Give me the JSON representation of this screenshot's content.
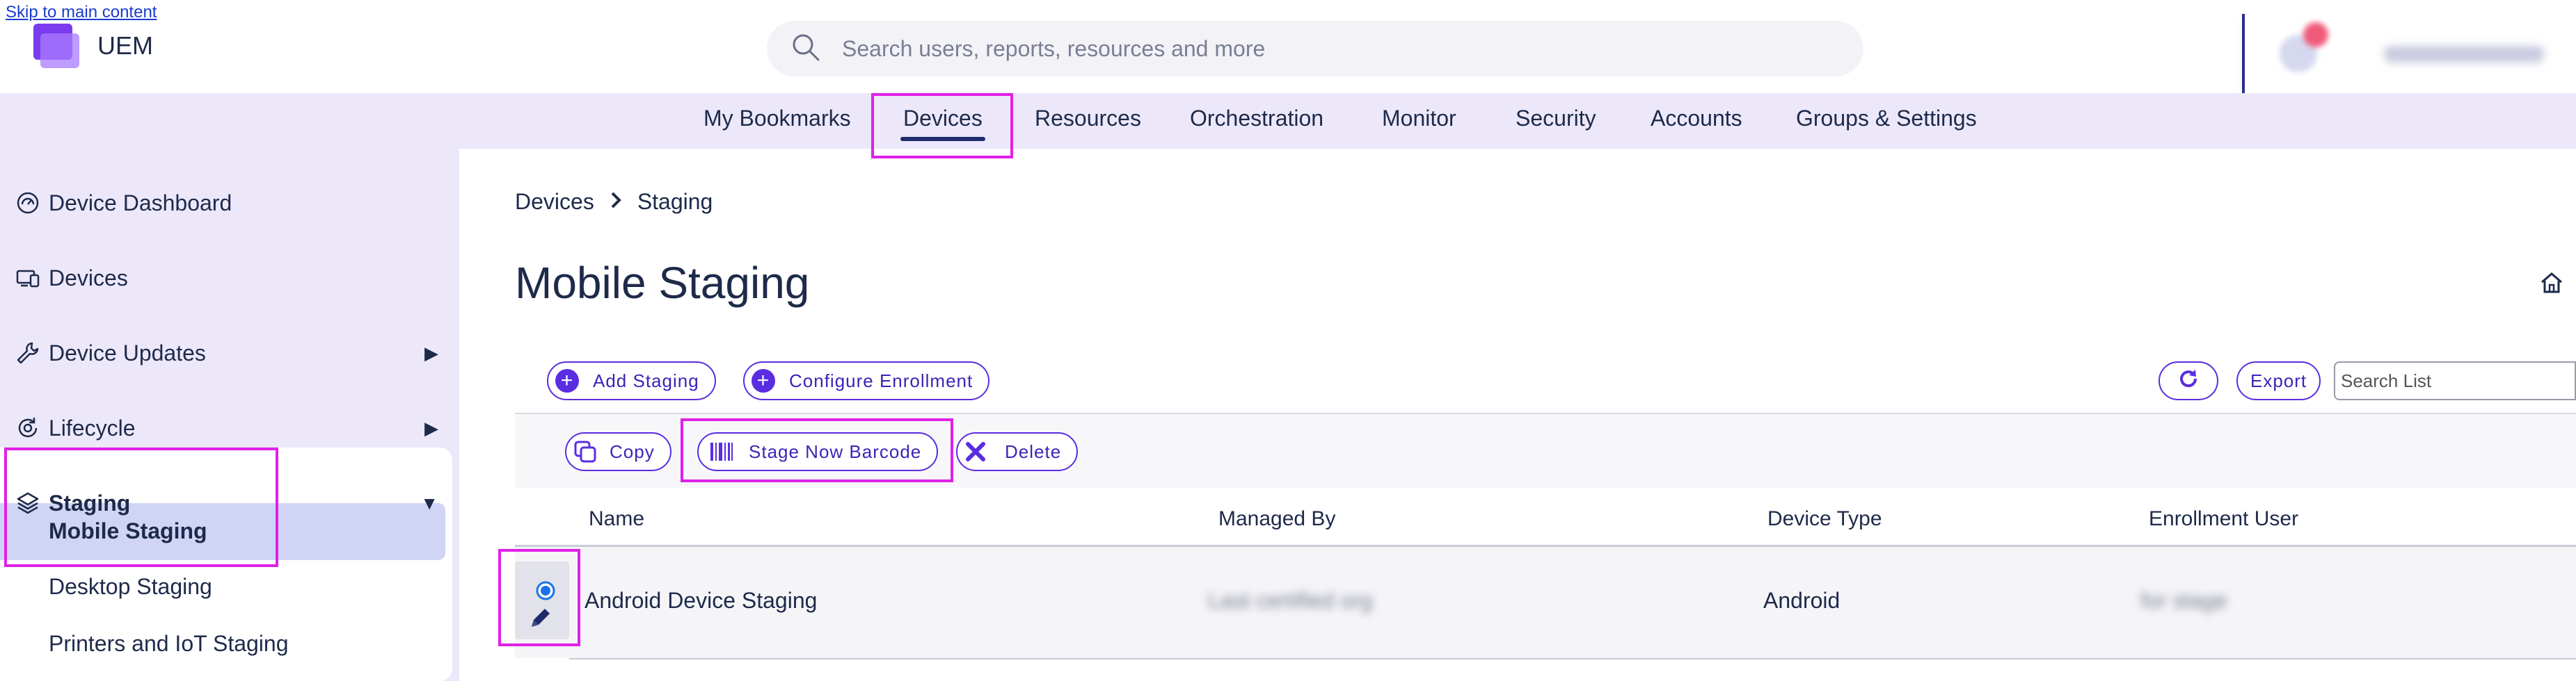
{
  "header": {
    "skip_link": "Skip to main content",
    "app_name": "UEM",
    "search_placeholder": "Search users, reports, resources and more"
  },
  "top_nav": {
    "tabs": [
      {
        "label": "My Bookmarks"
      },
      {
        "label": "Devices",
        "active": true
      },
      {
        "label": "Resources"
      },
      {
        "label": "Orchestration"
      },
      {
        "label": "Monitor"
      },
      {
        "label": "Security"
      },
      {
        "label": "Accounts"
      },
      {
        "label": "Groups & Settings"
      }
    ]
  },
  "sidebar": {
    "items": [
      {
        "label": "Device Dashboard",
        "icon": "dashboard-icon"
      },
      {
        "label": "Devices",
        "icon": "devices-icon"
      },
      {
        "label": "Device Updates",
        "icon": "wrench-icon",
        "expandable": true
      },
      {
        "label": "Lifecycle",
        "icon": "lifecycle-icon",
        "expandable": true
      },
      {
        "label": "Staging",
        "icon": "layers-icon",
        "expanded": true
      }
    ],
    "staging_subitems": [
      {
        "label": "Mobile Staging",
        "active": true
      },
      {
        "label": "Desktop Staging"
      },
      {
        "label": "Printers and IoT Staging"
      }
    ]
  },
  "breadcrumb": {
    "parent": "Devices",
    "current": "Staging"
  },
  "page": {
    "title": "Mobile Staging"
  },
  "toolbar": {
    "add_staging": "Add Staging",
    "configure_enrollment": "Configure Enrollment",
    "export": "Export",
    "search_placeholder": "Search List",
    "copy": "Copy",
    "stage_now_barcode": "Stage Now Barcode",
    "delete": "Delete"
  },
  "table": {
    "columns": [
      "Name",
      "Managed By",
      "Device Type",
      "Enrollment User"
    ],
    "rows": [
      {
        "name": "Android Device Staging",
        "managed_by": "(redacted)",
        "device_type": "Android",
        "enrollment_user": "(redacted)"
      }
    ]
  },
  "colors": {
    "accent": "#5a2de0",
    "nav_background": "#ece8fa",
    "highlight": "#e020e8",
    "active_item_background": "#d0d5f6"
  }
}
